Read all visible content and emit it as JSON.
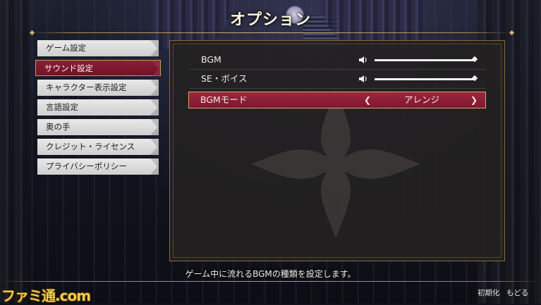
{
  "header": {
    "title": "オプション"
  },
  "menu": {
    "items": [
      {
        "label": "ゲーム設定",
        "active": false
      },
      {
        "label": "サウンド設定",
        "active": true
      },
      {
        "label": "キャラクター表示設定",
        "active": false
      },
      {
        "label": "言語設定",
        "active": false
      },
      {
        "label": "奥の手",
        "active": false
      },
      {
        "label": "クレジット・ライセンス",
        "active": false
      },
      {
        "label": "プライバシーポリシー",
        "active": false
      }
    ]
  },
  "settings": {
    "bgm": {
      "label": "BGM",
      "icon": "speaker-icon",
      "volume_fraction": 1.0
    },
    "se_voice": {
      "label": "SE・ボイス",
      "icon": "speaker-icon",
      "volume_fraction": 1.0
    },
    "bgm_mode": {
      "label": "BGMモード",
      "value": "アレンジ",
      "left_icon": "chevron-left-icon",
      "right_icon": "chevron-right-icon"
    }
  },
  "description": "ゲーム中に流れるBGMの種類を設定します。",
  "footer": {
    "reset_label": "初期化",
    "back_label": "もどる"
  },
  "watermark": "ファミ通.com",
  "colors": {
    "accent": "#8a1f35",
    "gold": "#c79a5a",
    "menu_bg": "#dcdcdc",
    "panel_bg": "#232121"
  }
}
